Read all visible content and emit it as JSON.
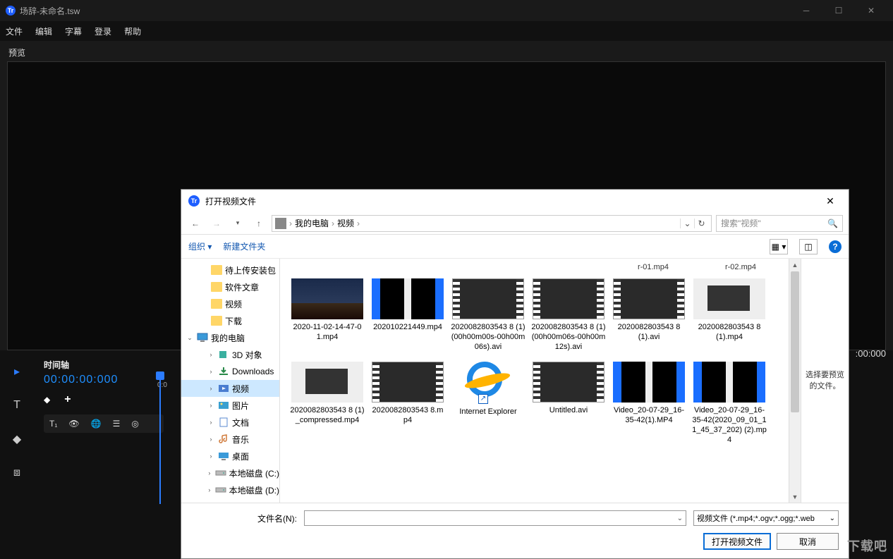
{
  "app": {
    "title": "场辞-未命名.tsw",
    "menu": [
      "文件",
      "编辑",
      "字幕",
      "登录",
      "帮助"
    ],
    "preview_label": "预览",
    "right_timecode": ":00:000"
  },
  "timeline": {
    "title": "时间轴",
    "timecode": "00:00:00:000",
    "ruler_zero": "0:0"
  },
  "dialog": {
    "title": "打开视频文件",
    "breadcrumb": {
      "root": "我的电脑",
      "folder": "视频"
    },
    "search_placeholder": "搜索\"视频\"",
    "toolbar": {
      "organize": "组织",
      "new_folder": "新建文件夹"
    },
    "top_labels": [
      "r-01.mp4",
      "r-02.mp4"
    ],
    "tree": [
      {
        "label": "待上传安装包",
        "indent": 1,
        "icon": "folder"
      },
      {
        "label": "软件文章",
        "indent": 1,
        "icon": "folder"
      },
      {
        "label": "视频",
        "indent": 1,
        "icon": "folder"
      },
      {
        "label": "下载",
        "indent": 1,
        "icon": "folder"
      },
      {
        "label": "我的电脑",
        "indent": 0,
        "icon": "pc",
        "expanded": true
      },
      {
        "label": "3D 对象",
        "indent": 2,
        "icon": "3d",
        "chev": true
      },
      {
        "label": "Downloads",
        "indent": 2,
        "icon": "downloads",
        "chev": true
      },
      {
        "label": "视频",
        "indent": 2,
        "icon": "videos",
        "chev": true,
        "selected": true
      },
      {
        "label": "图片",
        "indent": 2,
        "icon": "pictures",
        "chev": true
      },
      {
        "label": "文档",
        "indent": 2,
        "icon": "documents",
        "chev": true
      },
      {
        "label": "音乐",
        "indent": 2,
        "icon": "music",
        "chev": true
      },
      {
        "label": "桌面",
        "indent": 2,
        "icon": "desktop",
        "chev": true
      },
      {
        "label": "本地磁盘 (C:)",
        "indent": 2,
        "icon": "drive",
        "chev": true
      },
      {
        "label": "本地磁盘 (D:)",
        "indent": 2,
        "icon": "drive",
        "chev": true
      }
    ],
    "files": [
      {
        "name": "2020-11-02-14-47-01.mp4",
        "thumb": "landscape"
      },
      {
        "name": "202010221449.mp4",
        "thumb": "stripes"
      },
      {
        "name": "2020082803543 8 (1)(00h00m00s-00h00m06s).avi",
        "thumb": "film"
      },
      {
        "name": "2020082803543 8 (1)(00h00m06s-00h00m12s).avi",
        "thumb": "film"
      },
      {
        "name": "2020082803543 8 (1).avi",
        "thumb": "film-light"
      },
      {
        "name": "2020082803543 8 (1).mp4",
        "thumb": "desklight"
      },
      {
        "name": "2020082803543 8 (1)_compressed.mp4",
        "thumb": "desklight"
      },
      {
        "name": "2020082803543 8.mp4",
        "thumb": "film"
      },
      {
        "name": "Internet Explorer",
        "thumb": "ie"
      },
      {
        "name": "Untitled.avi",
        "thumb": "film"
      },
      {
        "name": "Video_20-07-29_16-35-42(1).MP4",
        "thumb": "stripes"
      },
      {
        "name": "Video_20-07-29_16-35-42(2020_09_01_11_45_37_202) (2).mp4",
        "thumb": "stripes"
      }
    ],
    "preview_text": "选择要预览的文件。",
    "filename_label": "文件名(N):",
    "filetype": "视频文件 (*.mp4;*.ogv;*.ogg;*.web",
    "btn_open": "打开视频文件",
    "btn_cancel": "取消"
  },
  "watermark": "下载吧"
}
